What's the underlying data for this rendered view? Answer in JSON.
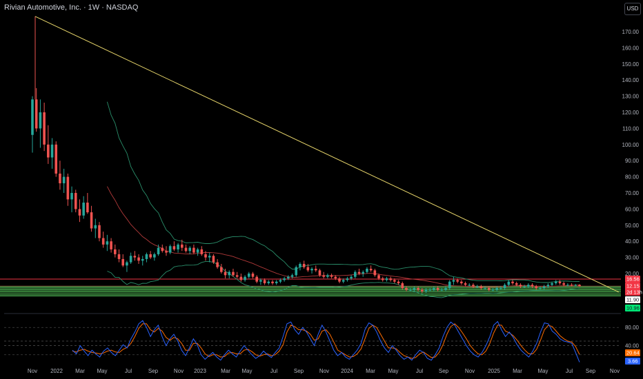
{
  "header": {
    "title": "Rivian Automotive, Inc. · 1W · NASDAQ",
    "currency": "USD"
  },
  "colors": {
    "up": "#26a69a",
    "down": "#ef5350",
    "trendline": "#e8d66b",
    "bb": "#2a8f6b",
    "ma": "#b23a3a",
    "hline_red": "#f23645",
    "hline_green": "#4caf50",
    "stoch_k": "#2962ff",
    "stoch_d": "#ff6d00"
  },
  "chart_data": {
    "type": "candlestick",
    "y_ticks": [
      "170.00",
      "160.00",
      "150.00",
      "140.00",
      "130.00",
      "120.00",
      "110.00",
      "100.00",
      "90.00",
      "80.00",
      "70.00",
      "60.00",
      "50.00",
      "40.00",
      "30.00",
      "20.00"
    ],
    "x_ticks": [
      "Nov",
      "2022",
      "Mar",
      "May",
      "Jul",
      "Sep",
      "Nov",
      "2023",
      "Mar",
      "May",
      "Jul",
      "Sep",
      "Nov",
      "2024",
      "Mar",
      "May",
      "Jul",
      "Sep",
      "Nov",
      "2025",
      "Mar",
      "May",
      "Jul",
      "Sep",
      "Nov"
    ],
    "price_badges": [
      {
        "label": "16.56",
        "bg": "#f23645",
        "fg": "#ffffff",
        "price": 16.56
      },
      {
        "label": "12.15",
        "bg": "#f23645",
        "fg": "#ffffff",
        "price": 12.15
      },
      {
        "label": "2d 13h",
        "bg": "#f23645",
        "fg": "#ffffff",
        "price": 12.15
      },
      {
        "label": "11.90",
        "bg": "#ffffff",
        "fg": "#131722",
        "price": 11.9
      },
      {
        "label": "10.96",
        "bg": "#00e676",
        "fg": "#131722",
        "price": 10.96
      }
    ],
    "horizontal_lines": {
      "red": [
        16.56,
        12.15
      ],
      "green": [
        12.0,
        11.3,
        10.6,
        9.9,
        9.2,
        8.5,
        7.6,
        6.8,
        6.1
      ]
    },
    "trendline": {
      "from": {
        "date": "2021-11-15",
        "price": 179.5
      },
      "to": {
        "date": "2025-10-15",
        "price": 8.5
      }
    },
    "candles": [
      [
        106,
        130,
        95,
        128
      ],
      [
        128,
        135,
        108,
        110
      ],
      [
        110,
        128,
        98,
        120
      ],
      [
        120,
        126,
        96,
        100
      ],
      [
        100,
        112,
        88,
        92
      ],
      [
        92,
        104,
        85,
        100
      ],
      [
        100,
        102,
        80,
        82
      ],
      [
        82,
        90,
        72,
        76
      ],
      [
        76,
        85,
        70,
        80
      ],
      [
        80,
        82,
        62,
        66
      ],
      [
        66,
        74,
        58,
        70
      ],
      [
        70,
        72,
        58,
        60
      ],
      [
        60,
        66,
        52,
        56
      ],
      [
        56,
        68,
        54,
        64
      ],
      [
        64,
        70,
        57,
        58
      ],
      [
        58,
        62,
        46,
        48
      ],
      [
        48,
        54,
        42,
        50
      ],
      [
        50,
        52,
        40,
        42
      ],
      [
        42,
        46,
        36,
        38
      ],
      [
        38,
        44,
        34,
        40
      ],
      [
        40,
        42,
        33,
        35
      ],
      [
        35,
        38,
        30,
        32
      ],
      [
        32,
        35,
        27,
        29
      ],
      [
        29,
        32,
        24,
        25
      ],
      [
        25,
        28,
        21,
        27
      ],
      [
        27,
        33,
        26,
        31
      ],
      [
        31,
        34,
        28,
        30
      ],
      [
        30,
        32,
        26,
        28
      ],
      [
        28,
        31,
        25,
        29
      ],
      [
        29,
        33,
        27,
        32
      ],
      [
        32,
        34,
        29,
        30
      ],
      [
        30,
        33,
        28,
        32
      ],
      [
        32,
        38,
        31,
        36
      ],
      [
        36,
        38,
        33,
        34
      ],
      [
        34,
        37,
        31,
        33
      ],
      [
        33,
        38,
        32,
        37
      ],
      [
        37,
        40,
        34,
        35
      ],
      [
        35,
        39,
        33,
        38
      ],
      [
        38,
        41,
        34,
        36
      ],
      [
        36,
        38,
        33,
        34
      ],
      [
        34,
        37,
        32,
        36
      ],
      [
        36,
        38,
        32,
        33
      ],
      [
        33,
        36,
        31,
        35
      ],
      [
        35,
        37,
        31,
        32
      ],
      [
        32,
        34,
        28,
        30
      ],
      [
        30,
        33,
        27,
        31
      ],
      [
        31,
        32,
        26,
        27
      ],
      [
        27,
        29,
        23,
        24
      ],
      [
        24,
        26,
        20,
        21
      ],
      [
        21,
        23,
        17,
        19
      ],
      [
        19,
        22,
        17,
        21
      ],
      [
        21,
        23,
        18,
        19
      ],
      [
        19,
        21,
        17,
        18
      ],
      [
        18,
        20,
        15,
        16
      ],
      [
        16,
        19,
        15,
        18
      ],
      [
        18,
        21,
        17,
        20
      ],
      [
        20,
        21,
        17,
        18
      ],
      [
        18,
        19,
        14,
        15
      ],
      [
        15,
        17,
        13,
        16
      ],
      [
        16,
        17,
        13,
        14
      ],
      [
        14,
        16,
        13,
        15
      ],
      [
        15,
        16,
        13,
        14
      ],
      [
        14,
        16,
        13,
        15
      ],
      [
        15,
        17,
        14,
        16
      ],
      [
        16,
        18,
        15,
        17
      ],
      [
        17,
        19,
        16,
        18
      ],
      [
        18,
        20,
        17,
        19
      ],
      [
        19,
        25,
        18,
        24
      ],
      [
        24,
        27,
        22,
        26
      ],
      [
        26,
        28,
        23,
        24
      ],
      [
        24,
        26,
        21,
        22
      ],
      [
        22,
        24,
        20,
        23
      ],
      [
        23,
        25,
        21,
        22
      ],
      [
        22,
        23,
        18,
        19
      ],
      [
        19,
        21,
        17,
        18
      ],
      [
        18,
        20,
        17,
        19
      ],
      [
        19,
        20,
        17,
        18
      ],
      [
        18,
        19,
        16,
        17
      ],
      [
        17,
        18,
        14,
        15
      ],
      [
        15,
        17,
        14,
        16
      ],
      [
        16,
        18,
        15,
        17
      ],
      [
        17,
        19,
        16,
        18
      ],
      [
        18,
        22,
        17,
        21
      ],
      [
        21,
        23,
        19,
        20
      ],
      [
        20,
        22,
        18,
        21
      ],
      [
        21,
        24,
        20,
        23
      ],
      [
        23,
        25,
        21,
        22
      ],
      [
        22,
        23,
        18,
        19
      ],
      [
        19,
        20,
        16,
        17
      ],
      [
        17,
        18,
        15,
        16
      ],
      [
        16,
        18,
        15,
        17
      ],
      [
        17,
        18,
        15,
        16
      ],
      [
        16,
        17,
        14,
        15
      ],
      [
        15,
        16,
        13,
        14
      ],
      [
        14,
        15,
        10,
        11
      ],
      [
        11,
        12,
        9,
        10
      ],
      [
        10,
        11,
        9,
        10
      ],
      [
        10,
        12,
        9,
        11
      ],
      [
        11,
        12,
        9,
        10
      ],
      [
        10,
        11,
        8,
        9
      ],
      [
        9,
        11,
        8,
        10
      ],
      [
        10,
        11,
        9,
        10
      ],
      [
        10,
        12,
        9,
        11
      ],
      [
        11,
        12,
        9,
        10
      ],
      [
        10,
        11,
        9,
        10
      ],
      [
        10,
        12,
        9,
        11
      ],
      [
        11,
        16,
        10,
        15
      ],
      [
        15,
        18,
        13,
        16
      ],
      [
        16,
        17,
        14,
        15
      ],
      [
        15,
        16,
        13,
        14
      ],
      [
        14,
        15,
        12,
        13
      ],
      [
        13,
        14,
        12,
        13
      ],
      [
        13,
        14,
        11,
        12
      ],
      [
        12,
        13,
        11,
        12
      ],
      [
        12,
        13,
        10,
        11
      ],
      [
        11,
        12,
        10,
        11
      ],
      [
        11,
        12,
        9,
        10
      ],
      [
        10,
        11,
        9,
        10
      ],
      [
        10,
        12,
        9,
        11
      ],
      [
        11,
        12,
        10,
        11
      ],
      [
        11,
        14,
        10,
        13
      ],
      [
        13,
        16,
        12,
        15
      ],
      [
        15,
        16,
        13,
        14
      ],
      [
        14,
        15,
        12,
        13
      ],
      [
        13,
        14,
        11,
        12
      ],
      [
        12,
        13,
        11,
        12
      ],
      [
        12,
        14,
        11,
        13
      ],
      [
        13,
        14,
        11,
        12
      ],
      [
        12,
        13,
        10,
        11
      ],
      [
        11,
        12,
        10,
        11
      ],
      [
        11,
        13,
        10,
        12
      ],
      [
        12,
        14,
        11,
        13
      ],
      [
        13,
        15,
        12,
        14
      ],
      [
        14,
        16,
        13,
        15
      ],
      [
        15,
        16,
        13,
        14
      ],
      [
        14,
        15,
        12,
        13
      ],
      [
        13,
        14,
        12,
        13
      ],
      [
        13,
        14,
        12,
        12.5
      ],
      [
        12.5,
        13.5,
        12,
        13
      ],
      [
        13,
        13.5,
        11.8,
        12.15
      ]
    ],
    "stochastic": {
      "levels": [
        "80.00",
        "40.00"
      ],
      "k_label": "3.66",
      "d_label": "20.64",
      "k": [
        30,
        22,
        40,
        28,
        18,
        30,
        22,
        15,
        28,
        35,
        25,
        18,
        30,
        42,
        35,
        55,
        70,
        88,
        95,
        80,
        60,
        75,
        85,
        60,
        40,
        55,
        65,
        50,
        30,
        18,
        35,
        55,
        42,
        20,
        10,
        18,
        25,
        15,
        8,
        20,
        30,
        22,
        15,
        28,
        40,
        30,
        20,
        12,
        18,
        28,
        20,
        14,
        25,
        35,
        60,
        88,
        92,
        75,
        65,
        80,
        70,
        55,
        40,
        65,
        85,
        70,
        50,
        30,
        18,
        25,
        15,
        10,
        20,
        30,
        45,
        75,
        90,
        85,
        70,
        50,
        35,
        25,
        40,
        30,
        18,
        10,
        15,
        8,
        20,
        30,
        25,
        12,
        8,
        20,
        35,
        60,
        80,
        92,
        85,
        70,
        55,
        40,
        28,
        20,
        15,
        25,
        40,
        60,
        85,
        93,
        75,
        60,
        70,
        58,
        42,
        30,
        22,
        15,
        28,
        45,
        70,
        90,
        88,
        72,
        65,
        55,
        50,
        48,
        45,
        25,
        3.66
      ],
      "d": [
        28,
        26,
        30,
        32,
        28,
        25,
        24,
        22,
        24,
        28,
        30,
        26,
        25,
        32,
        36,
        45,
        60,
        78,
        88,
        88,
        75,
        70,
        78,
        72,
        58,
        52,
        58,
        55,
        45,
        30,
        30,
        45,
        45,
        35,
        22,
        16,
        20,
        20,
        15,
        16,
        24,
        25,
        22,
        22,
        30,
        32,
        27,
        20,
        17,
        20,
        22,
        18,
        20,
        28,
        42,
        70,
        85,
        82,
        75,
        75,
        72,
        65,
        52,
        55,
        72,
        75,
        65,
        48,
        30,
        25,
        20,
        15,
        16,
        22,
        33,
        55,
        78,
        85,
        80,
        65,
        50,
        35,
        35,
        33,
        25,
        18,
        15,
        12,
        14,
        22,
        26,
        20,
        14,
        15,
        25,
        42,
        65,
        82,
        88,
        80,
        68,
        55,
        40,
        30,
        22,
        20,
        28,
        45,
        68,
        85,
        85,
        72,
        68,
        62,
        52,
        40,
        30,
        22,
        22,
        32,
        52,
        75,
        85,
        82,
        72,
        62,
        55,
        50,
        48,
        38,
        20.64
      ]
    }
  }
}
